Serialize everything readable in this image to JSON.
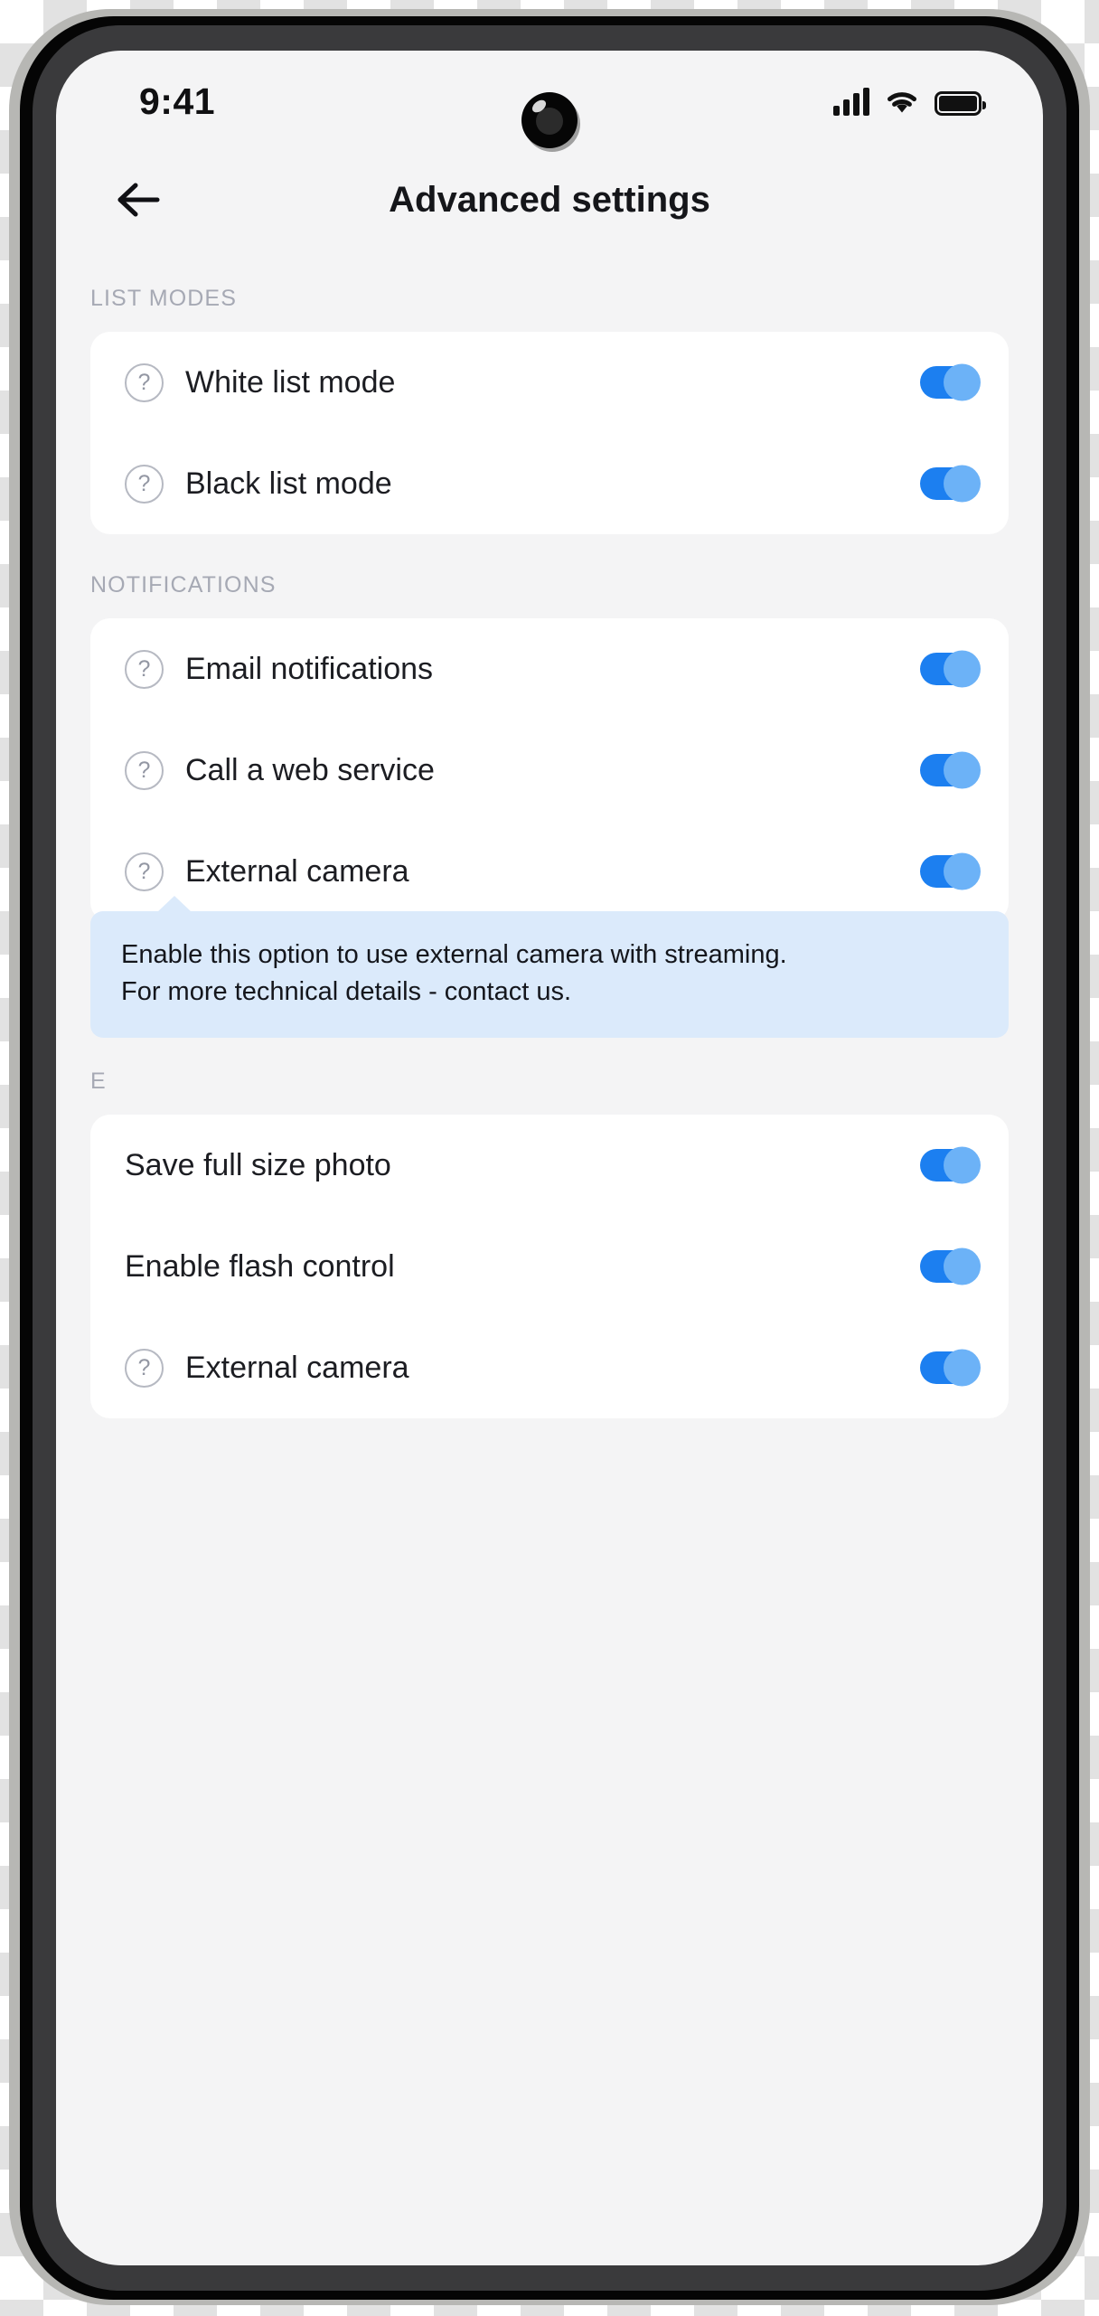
{
  "status_bar": {
    "time": "9:41",
    "icons": [
      "signal-bars-icon",
      "wifi-icon",
      "battery-icon"
    ]
  },
  "header": {
    "back_icon": "arrow-left-icon",
    "title": "Advanced settings"
  },
  "colors": {
    "screen_bg": "#f4f4f5",
    "card_bg": "#ffffff",
    "toggle_track_on": "#1c7ff0",
    "toggle_knob_on": "#6cb2f7",
    "tooltip_bg": "#dbeafb",
    "section_label": "#a6a9b4",
    "row_text": "#1c1d22",
    "title_text": "#15161a"
  },
  "sections": [
    {
      "label": "LIST MODES",
      "rows": [
        {
          "help_icon": true,
          "label": "White list mode",
          "toggle": "on"
        },
        {
          "help_icon": true,
          "label": "Black list mode",
          "toggle": "on"
        }
      ]
    },
    {
      "label": "NOTIFICATIONS",
      "rows": [
        {
          "help_icon": true,
          "label": "Email notifications",
          "toggle": "on"
        },
        {
          "help_icon": true,
          "label": "Call a web service",
          "toggle": "on"
        },
        {
          "help_icon": true,
          "label": "External camera",
          "toggle": "on"
        }
      ]
    },
    {
      "label": "E",
      "rows": [
        {
          "help_icon": false,
          "label": "Save full size photo",
          "toggle": "on"
        },
        {
          "help_icon": false,
          "label": "Enable flash control",
          "toggle": "on"
        },
        {
          "help_icon": true,
          "label": "External camera",
          "toggle": "on"
        }
      ]
    }
  ],
  "tooltip": {
    "line1": "Enable this option to use external camera with streaming.",
    "line2": "For more technical details - contact us."
  },
  "help_glyph": "?"
}
